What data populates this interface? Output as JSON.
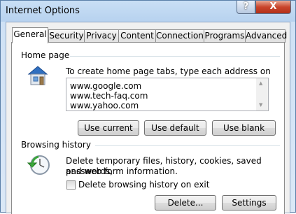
{
  "window": {
    "title": "Internet Options",
    "help_label": "?",
    "close_label": "X"
  },
  "tabs": [
    {
      "label": "General",
      "active": true
    },
    {
      "label": "Security"
    },
    {
      "label": "Privacy"
    },
    {
      "label": "Content"
    },
    {
      "label": "Connections"
    },
    {
      "label": "Programs"
    },
    {
      "label": "Advanced"
    }
  ],
  "home_page": {
    "group_label": "Home page",
    "icon": "home-icon",
    "description": "To create home page tabs, type each address on its own line.",
    "urls": [
      "www.google.com",
      "www.tech-faq.com",
      "www.yahoo.com"
    ],
    "buttons": {
      "use_current": "Use current",
      "use_default": "Use default",
      "use_blank": "Use blank"
    }
  },
  "browsing_history": {
    "group_label": "Browsing history",
    "icon": "history-clock-icon",
    "description_line1": "Delete temporary files, history, cookies, saved passwords,",
    "description_line2": "and web form information.",
    "checkbox_label": "Delete browsing history on exit",
    "checkbox_checked": false,
    "buttons": {
      "delete": "Delete...",
      "settings": "Settings"
    }
  }
}
